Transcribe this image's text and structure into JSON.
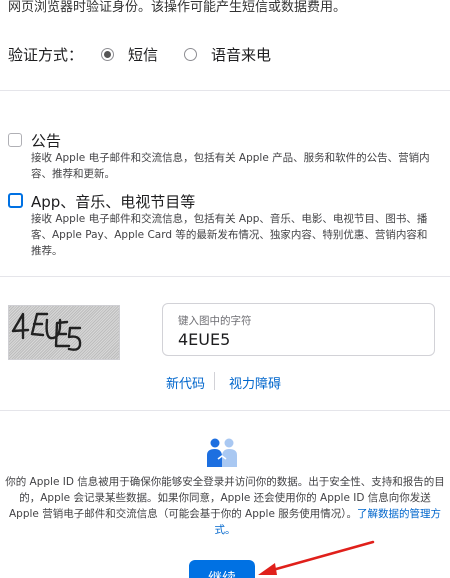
{
  "header": {
    "intro_text": "网页浏览器时验证身份。该操作可能产生短信或数据费用。"
  },
  "verify": {
    "label": "验证方式：",
    "options": [
      {
        "label": "短信",
        "selected": true
      },
      {
        "label": "语音来电",
        "selected": false
      }
    ]
  },
  "subscriptions": [
    {
      "title": "公告",
      "checked": false,
      "description": "接收 Apple 电子邮件和交流信息，包括有关 Apple 产品、服务和软件的公告、营销内容、推荐和更新。"
    },
    {
      "title": "App、音乐、电视节目等",
      "checked": false,
      "description": "接收 Apple 电子邮件和交流信息，包括有关 App、音乐、电影、电视节目、图书、播客、Apple Pay、Apple Card 等的最新发布情况、独家内容、特别优惠、营销内容和推荐。"
    }
  ],
  "captcha": {
    "image_text": "4EUE5",
    "input_label": "键入图中的字符",
    "input_value": "4EUE5",
    "new_code_link": "新代码",
    "vision_link": "视力障碍"
  },
  "privacy": {
    "icon": "handshake-people-icon",
    "text": "你的 Apple ID 信息被用于确保你能够安全登录并访问你的数据。出于安全性、支持和报告的目的，Apple 会记录某些数据。如果你同意，Apple 还会使用你的 Apple ID 信息向你发送 Apple 营销电子邮件和交流信息（可能会基于你的 Apple 服务使用情况）。",
    "link": "了解数据的管理方式。"
  },
  "actions": {
    "continue_label": "继续"
  },
  "colors": {
    "accent": "#0071e3",
    "link": "#0066cc",
    "annotation_arrow": "#e0201b"
  }
}
